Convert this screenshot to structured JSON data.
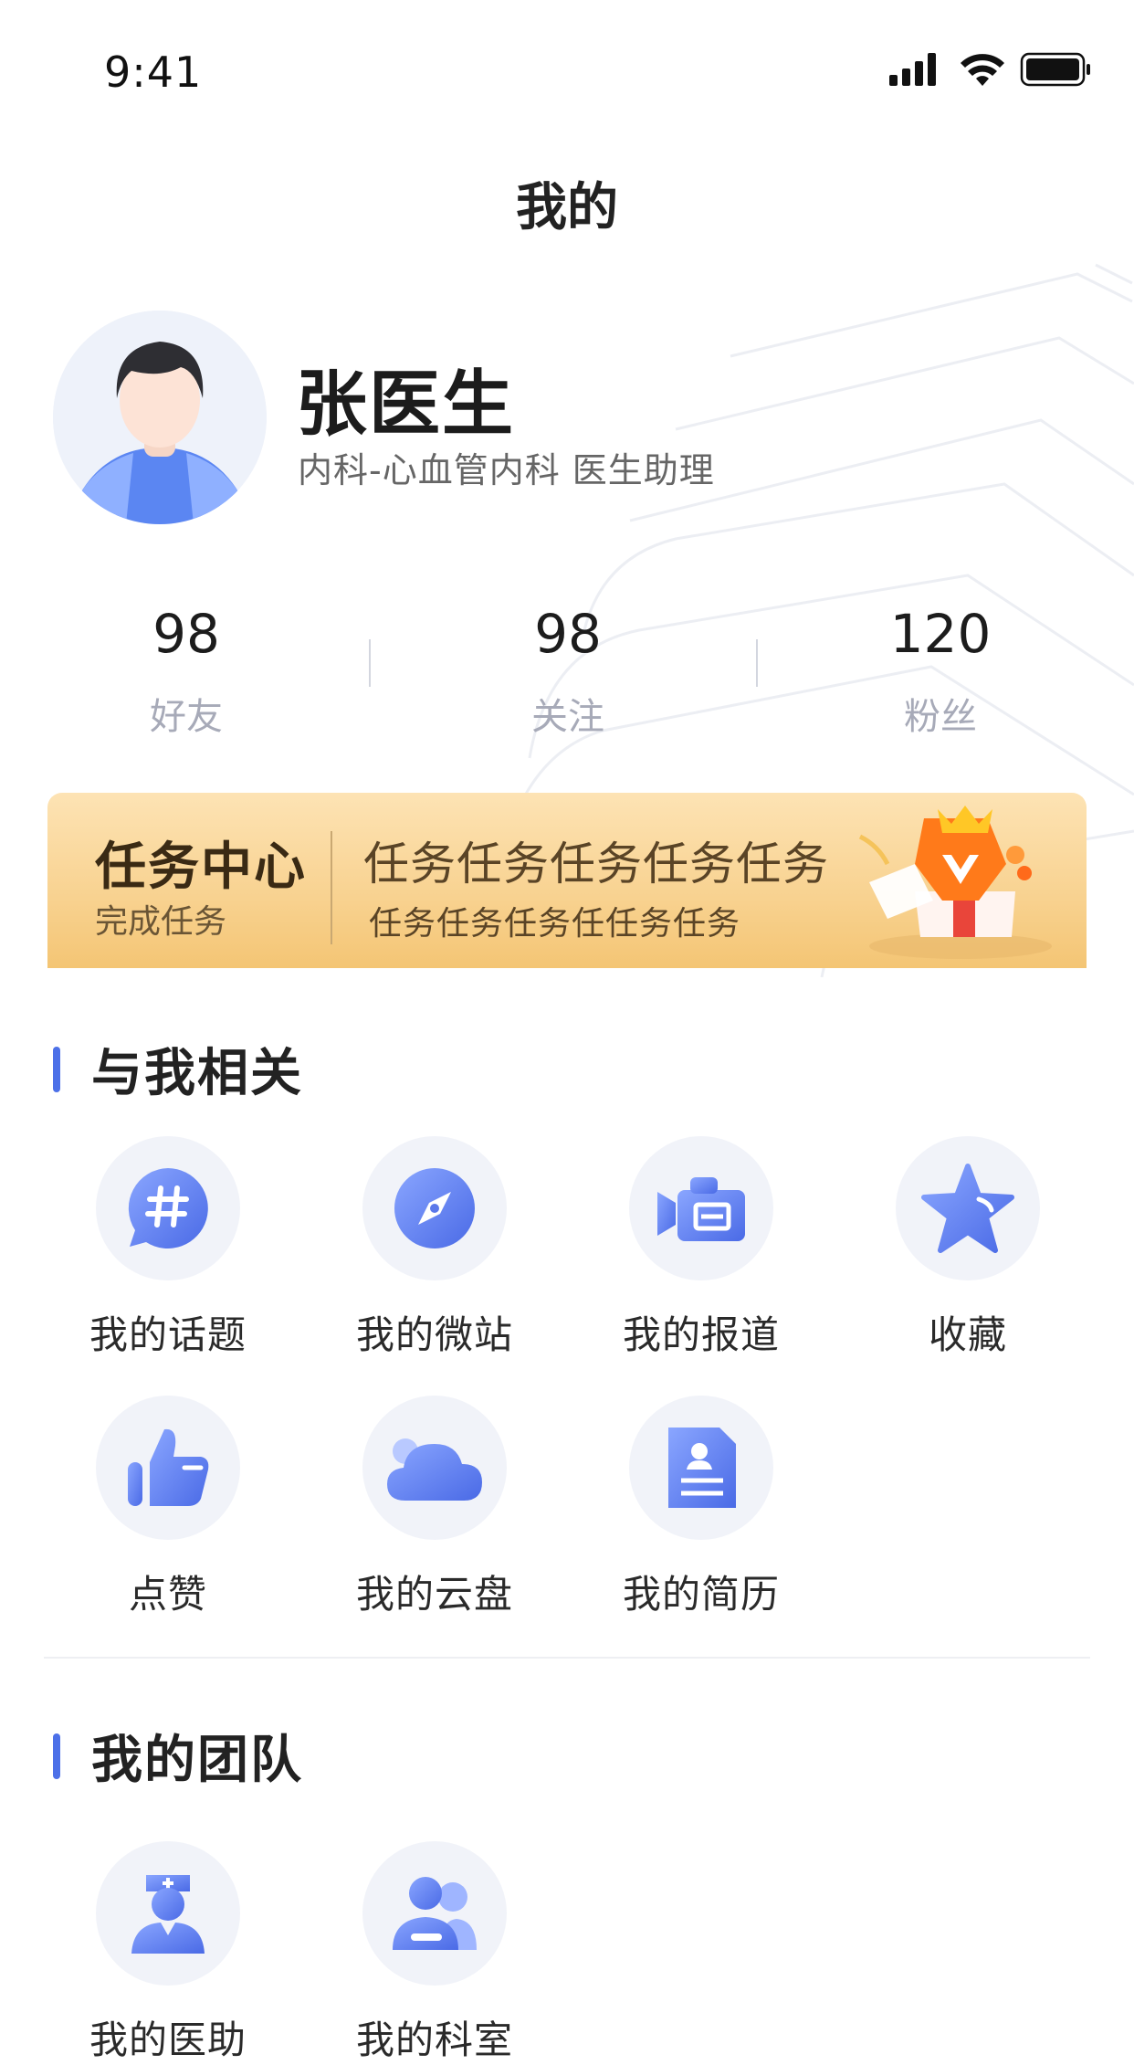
{
  "status": {
    "time": "9:41"
  },
  "header": {
    "title": "我的"
  },
  "profile": {
    "name": "张医生",
    "department": "内科-心血管内科  医生助理"
  },
  "stats": [
    {
      "value": "98",
      "label": "好友"
    },
    {
      "value": "98",
      "label": "关注"
    },
    {
      "value": "120",
      "label": "粉丝"
    }
  ],
  "task_banner": {
    "title": "任务中心",
    "subtitle": "完成任务",
    "line1": "任务任务任务任务任务",
    "line2": "任务任务任务任任务任务"
  },
  "section_related": {
    "title": "与我相关",
    "items": [
      {
        "label": "我的话题",
        "icon": "hashtag-chat-icon"
      },
      {
        "label": "我的微站",
        "icon": "compass-icon"
      },
      {
        "label": "我的报道",
        "icon": "video-camera-icon"
      },
      {
        "label": "收藏",
        "icon": "star-icon"
      },
      {
        "label": "点赞",
        "icon": "thumbs-up-icon"
      },
      {
        "label": "我的云盘",
        "icon": "cloud-icon"
      },
      {
        "label": "我的简历",
        "icon": "resume-document-icon"
      }
    ]
  },
  "section_team": {
    "title": "我的团队",
    "items": [
      {
        "label": "我的医助",
        "icon": "nurse-icon"
      },
      {
        "label": "我的科室",
        "icon": "group-users-icon"
      }
    ]
  },
  "colors": {
    "accent": "#4c70e8",
    "icon_gradient_start": "#8aa6ff",
    "icon_gradient_end": "#4a6ae6",
    "banner_start": "#fde3b4",
    "banner_end": "#f4c574",
    "stat_label": "#a7aab8"
  }
}
